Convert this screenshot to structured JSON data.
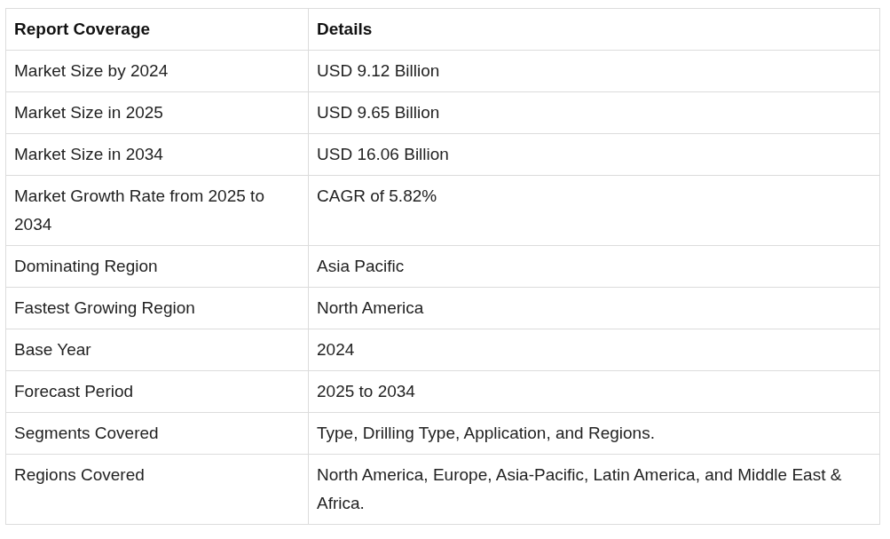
{
  "table": {
    "columns": [
      "Report Coverage",
      "Details"
    ],
    "rows": [
      [
        "Market Size by 2024",
        "USD 9.12 Billion"
      ],
      [
        "Market Size in 2025",
        "USD 9.65 Billion"
      ],
      [
        "Market Size in 2034",
        "USD 16.06 Billion"
      ],
      [
        "Market Growth Rate from 2025 to 2034",
        "CAGR of 5.82%"
      ],
      [
        "Dominating Region",
        "Asia Pacific"
      ],
      [
        "Fastest Growing Region",
        "North America"
      ],
      [
        "Base Year",
        "2024"
      ],
      [
        "Forecast Period",
        "2025 to 2034"
      ],
      [
        "Segments Covered",
        "Type, Drilling Type, Application, and Regions."
      ],
      [
        "Regions Covered",
        "North America, Europe, Asia-Pacific, Latin America, and Middle East & Africa."
      ]
    ]
  }
}
